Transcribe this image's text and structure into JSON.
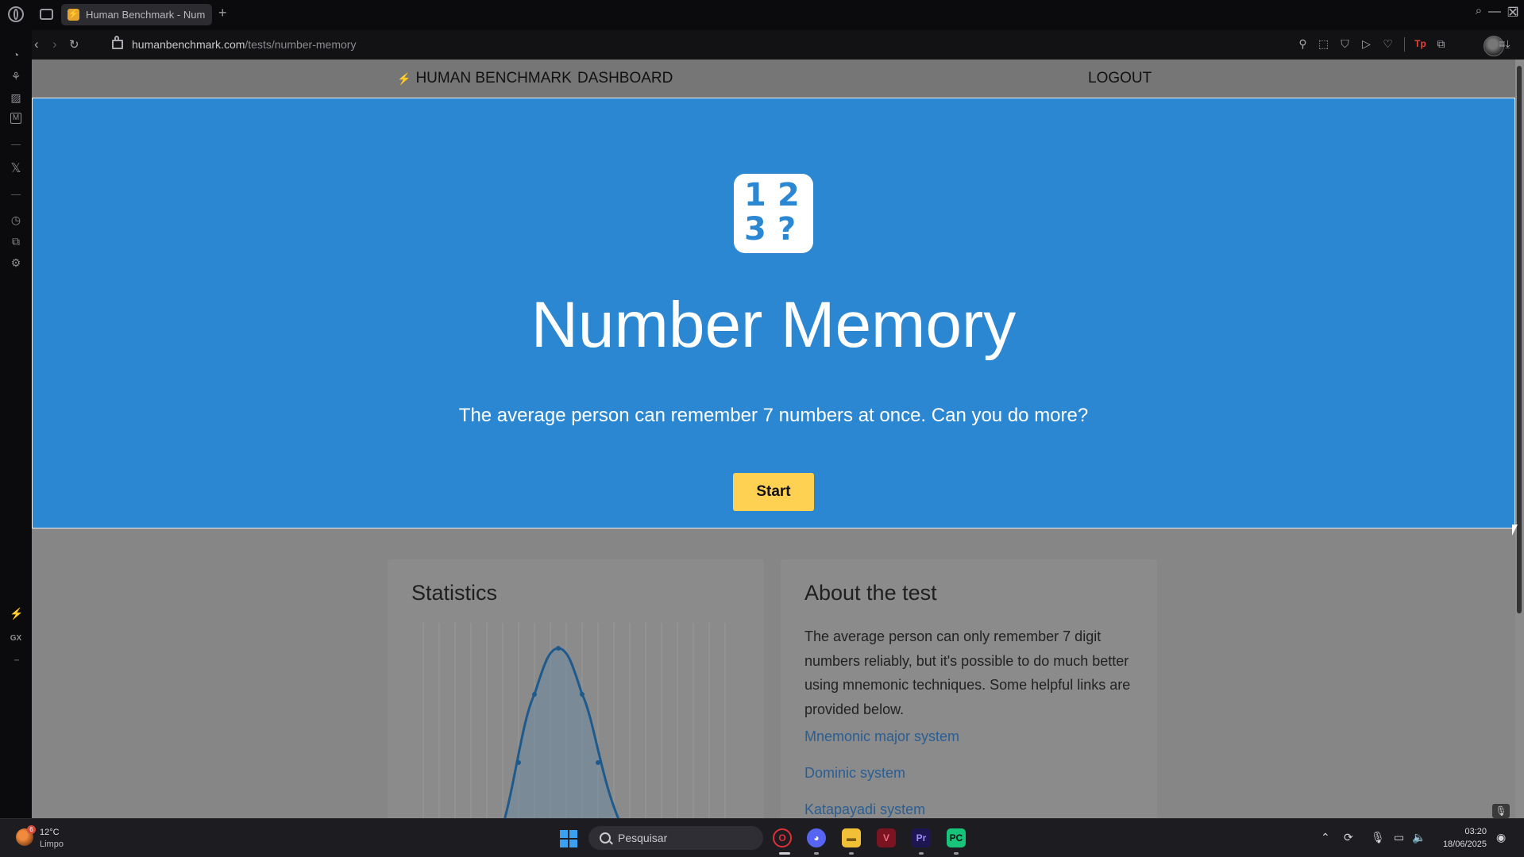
{
  "browser": {
    "tab_title": "Human Benchmark - Number Memory",
    "url_domain": "humanbenchmark.com",
    "url_path": "/tests/number-memory",
    "new_tab": "+",
    "minimize": "—",
    "restore": "❐",
    "close": "✕"
  },
  "sidebar": {
    "gx_label": "GX",
    "more": "···"
  },
  "site_nav": {
    "logo": "HUMAN BENCHMARK",
    "dashboard": "DASHBOARD",
    "logout": "LOGOUT"
  },
  "hero": {
    "icon_digits": [
      "1",
      "2",
      "3",
      "?"
    ],
    "title": "Number Memory",
    "subtitle": "The average person can remember 7 numbers at once. Can you do more?",
    "start_label": "Start",
    "bg_color": "#2b87d1",
    "button_color": "#ffd153"
  },
  "statistics": {
    "title": "Statistics"
  },
  "about": {
    "title": "About the test",
    "text": "The average person can only remember 7 digit numbers reliably, but it's possible to do much better using mnemonic techniques. Some helpful links are provided below.",
    "links": [
      "Mnemonic major system",
      "Dominic system",
      "Katapayadi system"
    ]
  },
  "taskbar": {
    "weather_temp": "12°C",
    "weather_desc": "Limpo",
    "weather_badge": "6",
    "search_placeholder": "Pesquisar",
    "time": "03:20",
    "date": "18/06/2025"
  }
}
